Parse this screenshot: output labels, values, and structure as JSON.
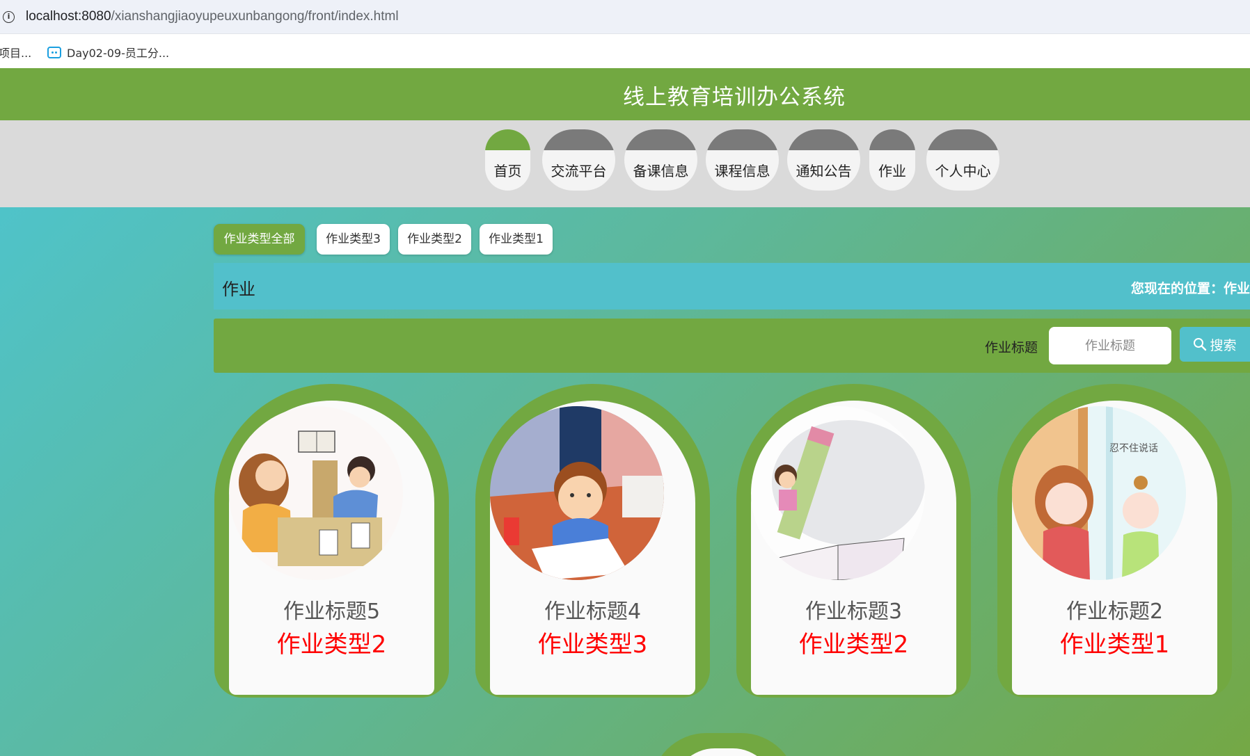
{
  "browser": {
    "url_host": "localhost:8080",
    "url_path": "/xianshangjiaoyupeuxunbangong/front/index.html",
    "bookmarks": [
      "项目...",
      "Day02-09-员工分..."
    ]
  },
  "header": {
    "title": "线上教育培训办公系统"
  },
  "nav": {
    "items": [
      "首页",
      "交流平台",
      "备课信息",
      "课程信息",
      "通知公告",
      "作业",
      "个人中心"
    ],
    "active": "首页"
  },
  "categories": [
    "作业类型全部",
    "作业类型3",
    "作业类型2",
    "作业类型1"
  ],
  "page": {
    "heading": "作业",
    "breadcrumb": "您现在的位置：作业"
  },
  "search": {
    "label": "作业标题",
    "placeholder": "作业标题",
    "button": "搜索"
  },
  "cards": [
    {
      "title": "作业标题5",
      "type": "作业类型2"
    },
    {
      "title": "作业标题4",
      "type": "作业类型3"
    },
    {
      "title": "作业标题3",
      "type": "作业类型2"
    },
    {
      "title": "作业标题2",
      "type": "作业类型1"
    }
  ],
  "colors": {
    "primary": "#72a841",
    "accent": "#52c0cb",
    "nav_cap": "#7a7a7a",
    "type_text": "#ff0000"
  }
}
